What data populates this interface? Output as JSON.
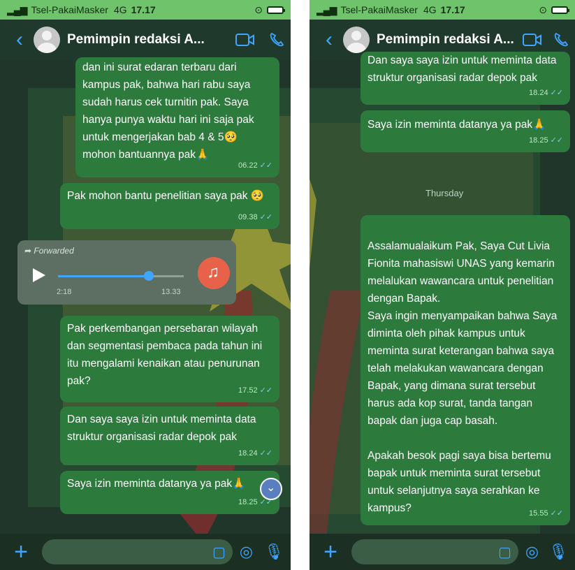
{
  "status": {
    "carrier": "Tsel-PakaiMasker",
    "network": "4G",
    "time": "17.17"
  },
  "header": {
    "contact_name": "Pemimpin redaksi A..."
  },
  "left": {
    "messages": [
      {
        "text": "dan ini surat edaran terbaru dari kampus pak, bahwa hari rabu saya sudah harus cek turnitin pak. Saya hanya punya waktu hari ini saja pak untuk mengerjakan bab 4 & 5🥺 mohon bantuannya pak🙏",
        "time": "06.22"
      },
      {
        "text": "Pak mohon bantu penelitian saya pak 🥺",
        "time": "09.38"
      },
      {
        "text": "Pak perkembangan persebaran wilayah dan segmentasi pembaca pada tahun ini itu mengalami kenaikan atau penurunan pak?",
        "time": "17.52"
      },
      {
        "text": "Dan saya saya izin untuk meminta data struktur organisasi radar depok pak",
        "time": "18.24"
      },
      {
        "text": "Saya izin meminta datanya ya pak🙏",
        "time": "18.25"
      }
    ],
    "voice": {
      "forwarded_label": "Forwarded",
      "elapsed": "2:18",
      "time": "13.33",
      "progress": 0.72
    }
  },
  "right": {
    "messages": [
      {
        "text": "Dan saya saya izin untuk meminta data struktur organisasi radar depok pak",
        "time": "18.24"
      },
      {
        "text": "Saya izin meminta datanya ya pak🙏",
        "time": "18.25"
      },
      {
        "text": "Assalamualaikum Pak, Saya Cut Livia Fionita mahasiswi UNAS yang kemarin melalukan wawancara untuk penelitian dengan Bapak.\nSaya ingin menyampaikan bahwa Saya diminta oleh pihak kampus untuk meminta surat keterangan bahwa saya telah melakukan wawancara dengan Bapak, yang dimana surat tersebut harus ada kop surat, tanda tangan bapak dan juga cap basah.\n\nApakah besok pagi saya bisa bertemu bapak untuk meminta surat tersebut untuk selanjutnya saya serahkan ke kampus?",
        "time": "15.55"
      }
    ],
    "date_divider": "Thursday"
  },
  "colors": {
    "accent": "#3fa5ff",
    "bubble": "#2c7a3c",
    "status_bar": "#6fc46b"
  },
  "icons": [
    "back-chevron-icon",
    "video-call-icon",
    "phone-call-icon",
    "plus-icon",
    "sticker-icon",
    "camera-icon",
    "microphone-icon",
    "play-icon",
    "music-note-icon",
    "forward-arrow-icon",
    "scroll-down-icon"
  ]
}
